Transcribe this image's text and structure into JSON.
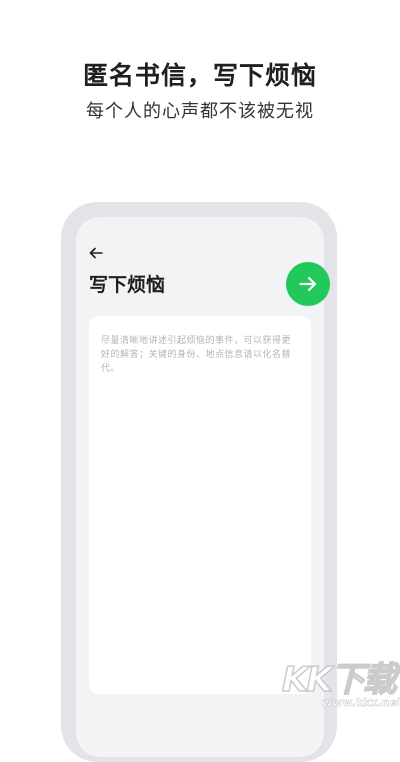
{
  "promo": {
    "headline": "匿名书信，写下烦恼",
    "subheadline": "每个人的心声都不该被无视"
  },
  "screen": {
    "back_icon": "arrow-left-icon",
    "title": "写下烦恼",
    "next_icon": "arrow-right-icon",
    "editor": {
      "value": "",
      "placeholder": "尽量清晰地讲述引起烦恼的事件，可以获得更好的解答；关键的身份、地点信息请以化名替代。"
    }
  },
  "watermark": {
    "logo": "KK下载",
    "url": "www.kkx.net"
  },
  "colors": {
    "accent_green": "#22c85a",
    "frame_gray": "#e3e4e8",
    "screen_bg": "#f2f3f5",
    "placeholder_text": "#b3b3b3"
  }
}
